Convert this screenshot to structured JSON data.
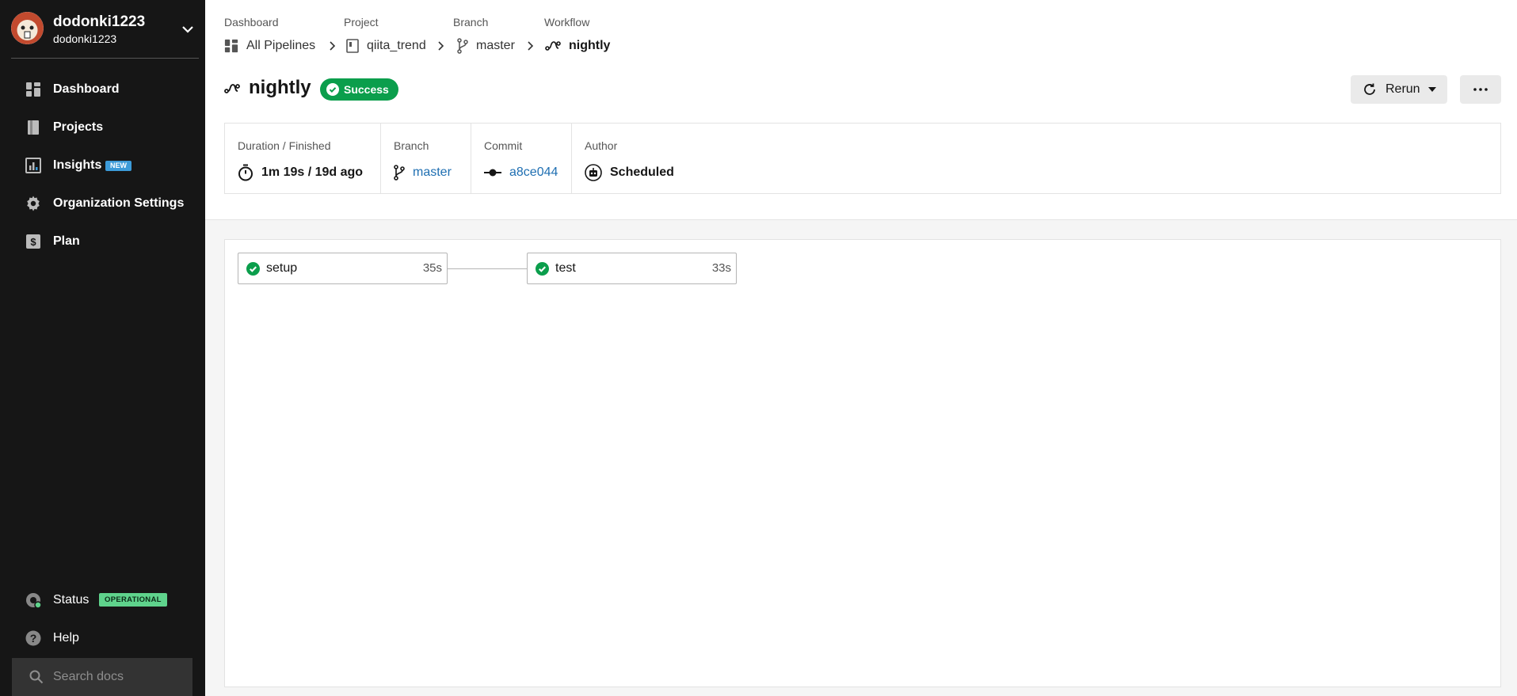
{
  "org": {
    "name": "dodonki1223",
    "sub": "dodonki1223"
  },
  "sidebar": {
    "items": [
      {
        "label": "Dashboard",
        "icon": "dashboard-icon"
      },
      {
        "label": "Projects",
        "icon": "projects-icon"
      },
      {
        "label": "Insights",
        "icon": "insights-icon",
        "badge": "NEW"
      },
      {
        "label": "Organization Settings",
        "icon": "gear-icon"
      },
      {
        "label": "Plan",
        "icon": "dollar-icon"
      }
    ],
    "status": {
      "label": "Status",
      "badge": "OPERATIONAL"
    },
    "help": {
      "label": "Help"
    },
    "search": {
      "placeholder": "Search docs"
    }
  },
  "breadcrumb": {
    "labels": [
      "Dashboard",
      "Project",
      "Branch",
      "Workflow"
    ],
    "items": [
      "All Pipelines",
      "qiita_trend",
      "master",
      "nightly"
    ]
  },
  "workflow": {
    "title": "nightly",
    "status": "Success",
    "rerun_label": "Rerun"
  },
  "info": {
    "duration_label": "Duration / Finished",
    "duration_value": "1m 19s / 19d ago",
    "branch_label": "Branch",
    "branch_value": "master",
    "commit_label": "Commit",
    "commit_value": "a8ce044",
    "author_label": "Author",
    "author_value": "Scheduled"
  },
  "jobs": [
    {
      "name": "setup",
      "duration": "35s",
      "status": "success"
    },
    {
      "name": "test",
      "duration": "33s",
      "status": "success"
    }
  ],
  "colors": {
    "success": "#0b9e4c",
    "link": "#1f6fb2",
    "sidebar_bg": "#161616",
    "new_badge": "#3c9bd9",
    "operational_badge": "#5fd38c"
  }
}
